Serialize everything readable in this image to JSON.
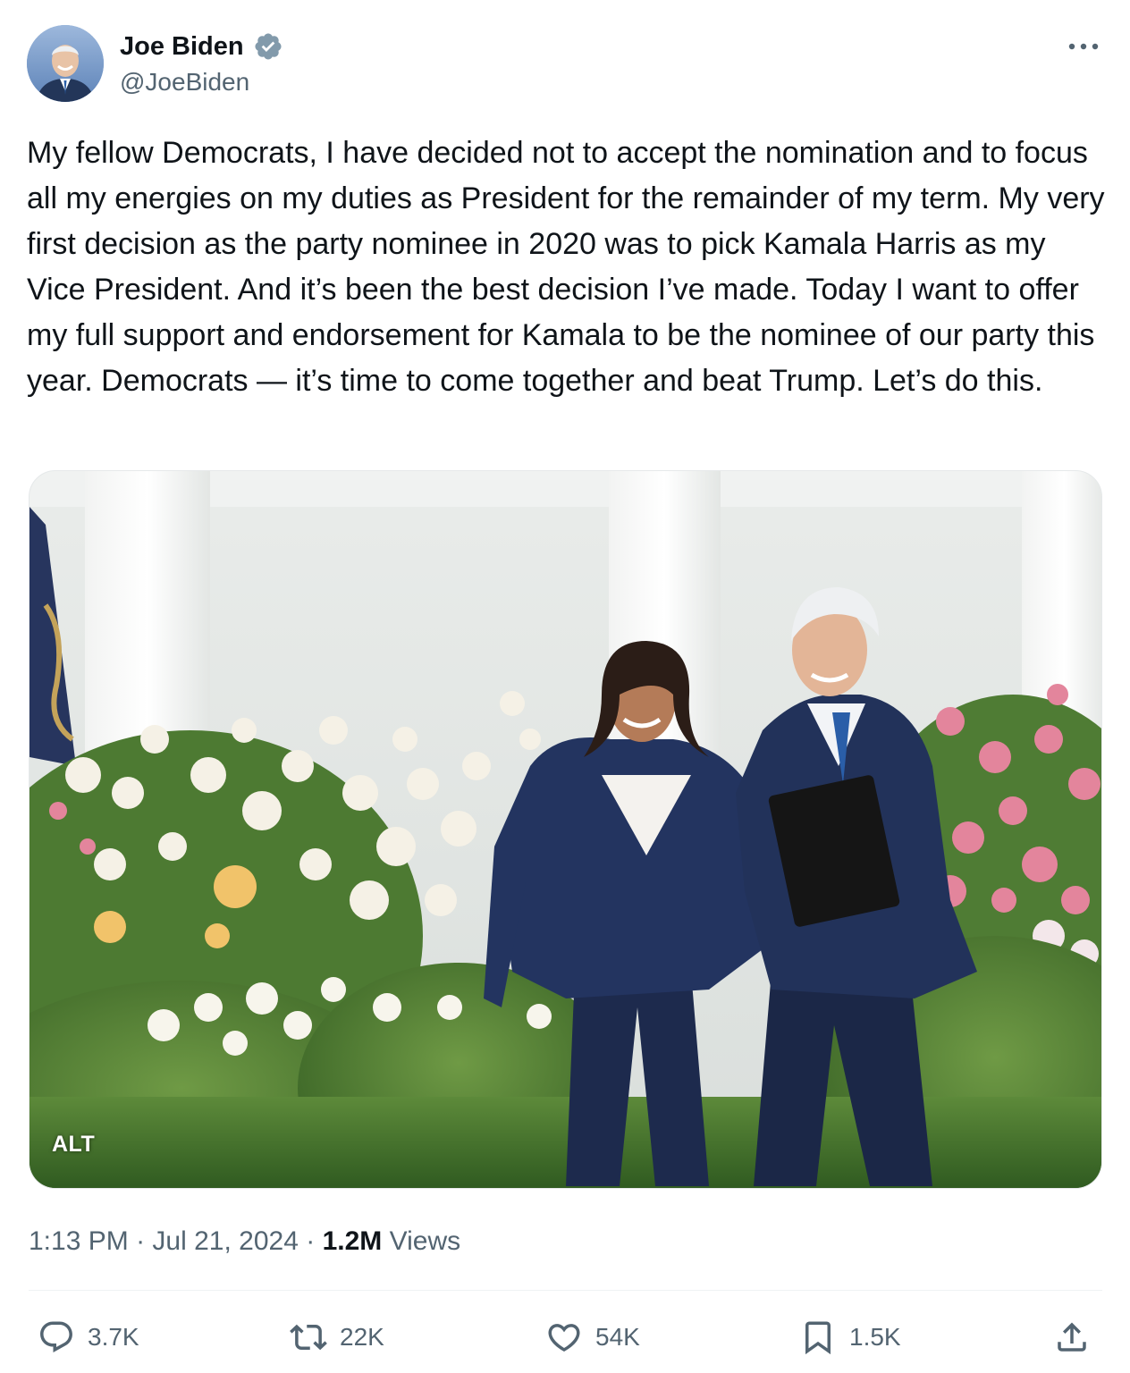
{
  "author": {
    "display_name": "Joe Biden",
    "handle": "@JoeBiden",
    "verified": true,
    "verified_color": "#1d9bf0"
  },
  "tweet": {
    "text": "My fellow Democrats, I have decided not to accept the nomination and to focus all my energies on my duties as President for the remainder of my term. My very first decision as the party nominee in 2020 was to pick Kamala Harris as my Vice President. And it’s been the best decision I’ve made. Today I want to offer my full support and endorsement for Kamala to be the nominee of our party this year. Democrats — it’s time to come together and beat Trump. Let’s do this."
  },
  "media": {
    "alt_badge": "ALT"
  },
  "meta": {
    "time": "1:13 PM",
    "separator": "·",
    "date": "Jul 21, 2024",
    "views_count": "1.2M",
    "views_label": "Views"
  },
  "actions": {
    "replies": "3.7K",
    "reposts": "22K",
    "likes": "54K",
    "bookmarks": "1.5K"
  },
  "icons": {
    "more": "more-horizontal-icon",
    "reply": "reply-icon",
    "repost": "repost-icon",
    "like": "heart-icon",
    "bookmark": "bookmark-icon",
    "share": "share-icon"
  },
  "colors": {
    "text_primary": "#0f1419",
    "text_secondary": "#536471",
    "divider": "#eff3f4"
  }
}
